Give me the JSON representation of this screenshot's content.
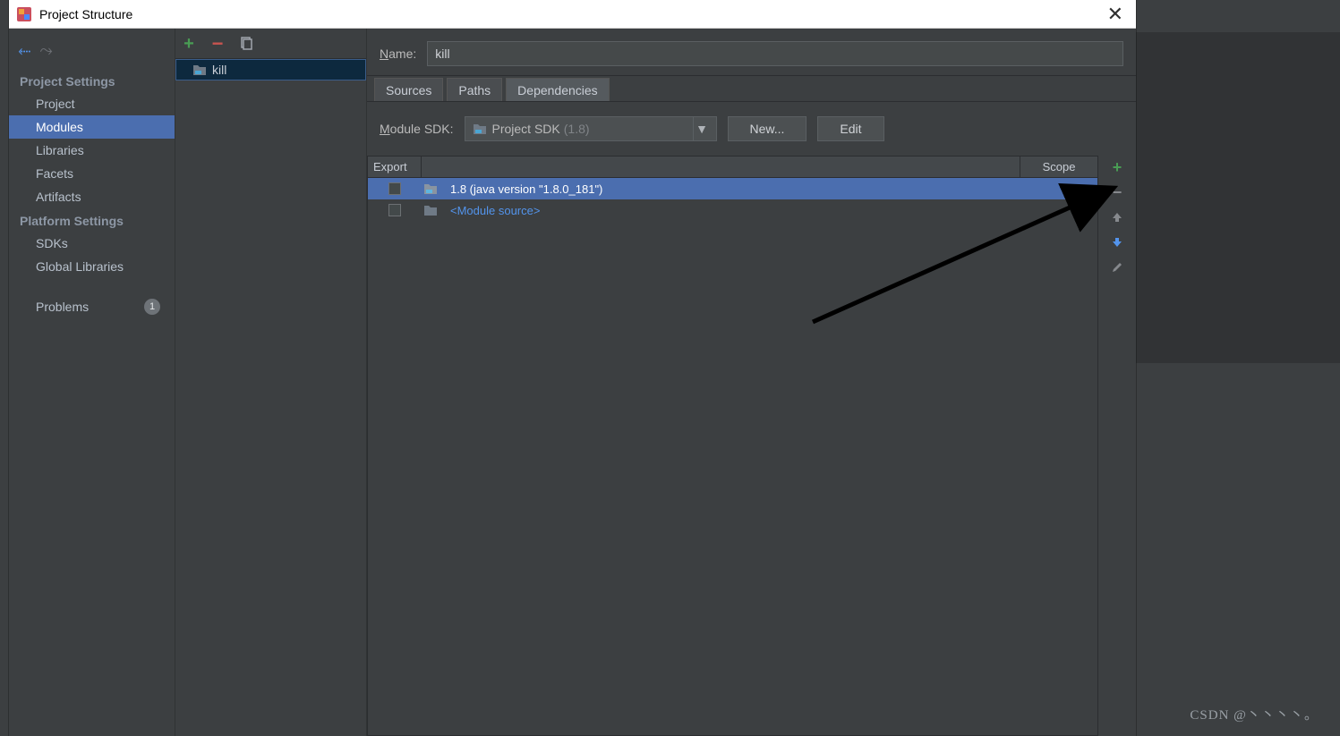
{
  "window": {
    "title": "Project Structure"
  },
  "sidebar": {
    "sections": [
      {
        "header": "Project Settings",
        "items": [
          {
            "label": "Project"
          },
          {
            "label": "Modules",
            "selected": true
          },
          {
            "label": "Libraries"
          },
          {
            "label": "Facets"
          },
          {
            "label": "Artifacts"
          }
        ]
      },
      {
        "header": "Platform Settings",
        "items": [
          {
            "label": "SDKs"
          },
          {
            "label": "Global Libraries"
          }
        ]
      }
    ],
    "problems": {
      "label": "Problems",
      "count": "1"
    }
  },
  "moduleTree": {
    "selected": "kill"
  },
  "main": {
    "nameLabel": "Name:",
    "nameValue": "kill",
    "tabs": {
      "sources": "Sources",
      "paths": "Paths",
      "deps": "Dependencies"
    },
    "sdk": {
      "label": "Module SDK:",
      "value": "Project SDK",
      "version": "(1.8)",
      "newBtn": "New...",
      "editBtn": "Edit"
    },
    "table": {
      "exportHdr": "Export",
      "scopeHdr": "Scope",
      "rows": [
        {
          "label": "1.8 (java version \"1.8.0_181\")",
          "selected": true,
          "link": false
        },
        {
          "label": "<Module source>",
          "selected": false,
          "link": true
        }
      ]
    }
  },
  "watermark": "CSDN @丶丶丶丶。"
}
